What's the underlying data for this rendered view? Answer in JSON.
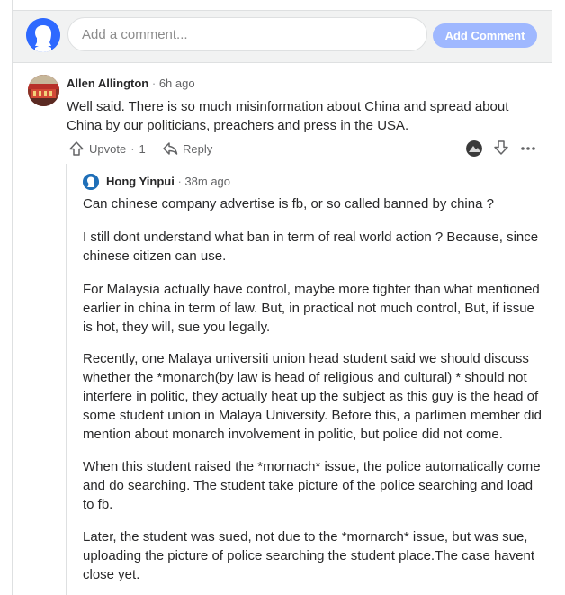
{
  "composer": {
    "placeholder": "Add a comment...",
    "button_label": "Add Comment"
  },
  "comment": {
    "author": "Allen Allington",
    "separator": "·",
    "time": "6h ago",
    "text": "Well said. There is so much misinformation about China and spread about China by our politicians, preachers and press in the USA.",
    "upvote_label": "Upvote",
    "upvote_count": "1",
    "reply_label": "Reply"
  },
  "reply": {
    "author": "Hong Yinpui",
    "separator": "·",
    "time": "38m ago",
    "paragraphs": [
      "Can chinese company advertise is fb, or so called banned by china ?",
      "I still dont understand what ban in term of real world action ? Because, since chinese citizen can use.",
      "For Malaysia actually have control, maybe more tighter than what mentioned earlier in china in term of law. But, in practical not much control, But, if issue is hot, they will, sue you legally.",
      "Recently, one Malaya universiti union head student said we should discuss whether the *monarch(by law is head of religious and cultural) * should not interfere in politic, they actually heat up the subject as this guy is the head of some student union in Malaya University. Before this, a parlimen member did mention about monarch involvement in politic, but police did not come.",
      "When this student raised the *mornach* issue, the police automatically come and do searching. The student take picture of the police searching and load to fb.",
      "Later, the student was sued, not due to the *mornarch* issue, but was sue, uploading the picture of police searching the student place.The case havent close yet."
    ]
  }
}
